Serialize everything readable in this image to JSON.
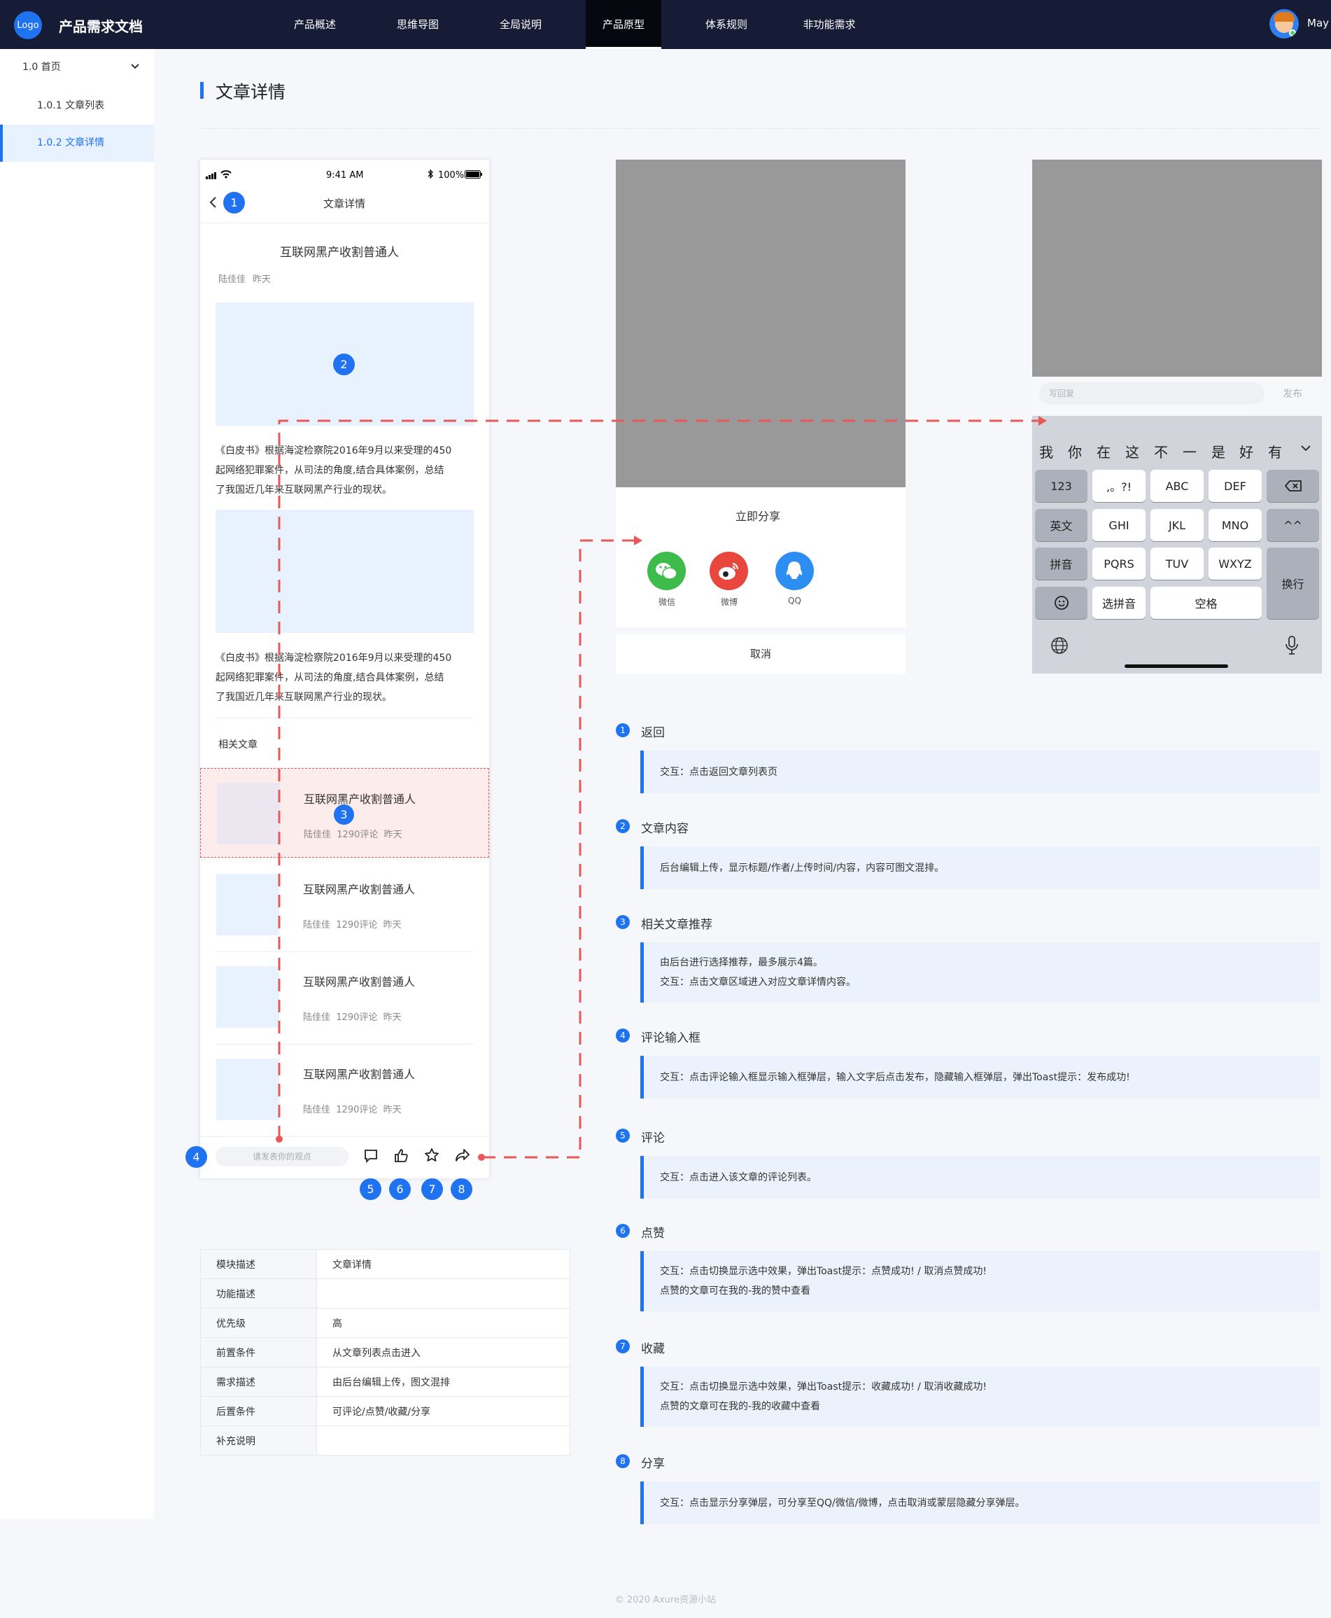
{
  "topbar": {
    "logo": "Logo",
    "title": "产品需求文档",
    "tabs": [
      "产品概述",
      "思维导图",
      "全局说明",
      "产品原型",
      "体系规则",
      "非功能需求"
    ],
    "active_tab": 3,
    "username": "May"
  },
  "sidebar": {
    "items": [
      {
        "label": "1.0 首页",
        "icon": "chevron-down-icon"
      },
      {
        "label": "1.0.1 文章列表"
      },
      {
        "label": "1.0.2 文章详情"
      }
    ],
    "active_item": 2
  },
  "page": {
    "title": "文章详情"
  },
  "phone": {
    "status": {
      "time": "9:41 AM",
      "battery": "100%"
    },
    "nav_title": "文章详情",
    "article": {
      "title": "互联网黑产收割普通人",
      "author": "陆佳佳",
      "date": "昨天",
      "para1": [
        "《白皮书》根据海淀检察院2016年9月以来受理的450",
        "起网络犯罪案件，从司法的角度,结合具体案例，总结",
        "了我国近几年来互联网黑产行业的现状。"
      ],
      "para2": [
        "《白皮书》根据海淀检察院2016年9月以来受理的450",
        "起网络犯罪案件，从司法的角度,结合具体案例，总结",
        "了我国近几年来互联网黑产行业的现状。"
      ]
    },
    "related_label": "相关文章",
    "related": [
      {
        "title": "互联网黑产收割普通人",
        "author": "陆佳佳",
        "comments": "1290评论",
        "date": "昨天"
      },
      {
        "title": "互联网黑产收割普通人",
        "author": "陆佳佳",
        "comments": "1290评论",
        "date": "昨天"
      },
      {
        "title": "互联网黑产收割普通人",
        "author": "陆佳佳",
        "comments": "1290评论",
        "date": "昨天"
      },
      {
        "title": "互联网黑产收割普通人",
        "author": "陆佳佳",
        "comments": "1290评论",
        "date": "昨天"
      }
    ],
    "comment_placeholder": "请发表你的观点",
    "badges": [
      "1",
      "2",
      "3",
      "4",
      "5",
      "6",
      "7",
      "8"
    ]
  },
  "share": {
    "title": "立即分享",
    "items": [
      {
        "label": "微信",
        "color": "#3dbb4b",
        "icon": "wechat-icon"
      },
      {
        "label": "微博",
        "color": "#e9463e",
        "icon": "weibo-icon"
      },
      {
        "label": "QQ",
        "color": "#2d8ef2",
        "icon": "qq-icon"
      }
    ],
    "cancel": "取消"
  },
  "keyboard": {
    "reply_placeholder": "写回复",
    "publish": "发布",
    "candidates": [
      "我",
      "你",
      "在",
      "这",
      "不",
      "一",
      "是",
      "好",
      "有"
    ],
    "keys": {
      "r1": [
        "123",
        ",。?!",
        "ABC",
        "DEF"
      ],
      "r2": [
        "英文",
        "GHI",
        "JKL",
        "MNO"
      ],
      "r3": [
        "拼音",
        "PQRS",
        "TUV",
        "WXYZ"
      ],
      "r4": [
        "选拼音",
        "空格"
      ],
      "enter": "换行",
      "caps": "^^"
    }
  },
  "spec": [
    {
      "k": "模块描述",
      "v": "文章详情"
    },
    {
      "k": "功能描述",
      "v": ""
    },
    {
      "k": "优先级",
      "v": "高"
    },
    {
      "k": "前置条件",
      "v": "从文章列表点击进入"
    },
    {
      "k": "需求描述",
      "v": "由后台编辑上传，图文混排"
    },
    {
      "k": "后置条件",
      "v": "可评论/点赞/收藏/分享"
    },
    {
      "k": "补充说明",
      "v": ""
    }
  ],
  "annotations": [
    {
      "n": "1",
      "title": "返回",
      "lines": [
        "交互：点击返回文章列表页"
      ]
    },
    {
      "n": "2",
      "title": "文章内容",
      "lines": [
        "后台编辑上传，显示标题/作者/上传时间/内容，内容可图文混排。"
      ]
    },
    {
      "n": "3",
      "title": "相关文章推荐",
      "lines": [
        "由后台进行选择推荐，最多展示4篇。",
        "交互：点击文章区域进入对应文章详情内容。"
      ]
    },
    {
      "n": "4",
      "title": "评论输入框",
      "lines": [
        "交互：点击评论输入框显示输入框弹层，输入文字后点击发布，隐藏输入框弹层，弹出Toast提示：发布成功!"
      ]
    },
    {
      "n": "5",
      "title": "评论",
      "lines": [
        "交互：点击进入该文章的评论列表。"
      ]
    },
    {
      "n": "6",
      "title": "点赞",
      "lines": [
        "交互：点击切换显示选中效果，弹出Toast提示：点赞成功! / 取消点赞成功!",
        "点赞的文章可在我的-我的赞中查看"
      ]
    },
    {
      "n": "7",
      "title": "收藏",
      "lines": [
        "交互：点击切换显示选中效果，弹出Toast提示：收藏成功! / 取消收藏成功!",
        "点赞的文章可在我的-我的收藏中查看"
      ]
    },
    {
      "n": "8",
      "title": "分享",
      "lines": [
        "交互：点击显示分享弹层，可分享至QQ/微信/微博，点击取消或蒙层隐藏分享弹层。"
      ]
    }
  ],
  "footer": "© 2020  Axure资源小站",
  "colors": {
    "accent": "#1f73f0",
    "topbar": "#171c36",
    "flow": "#e85858"
  }
}
